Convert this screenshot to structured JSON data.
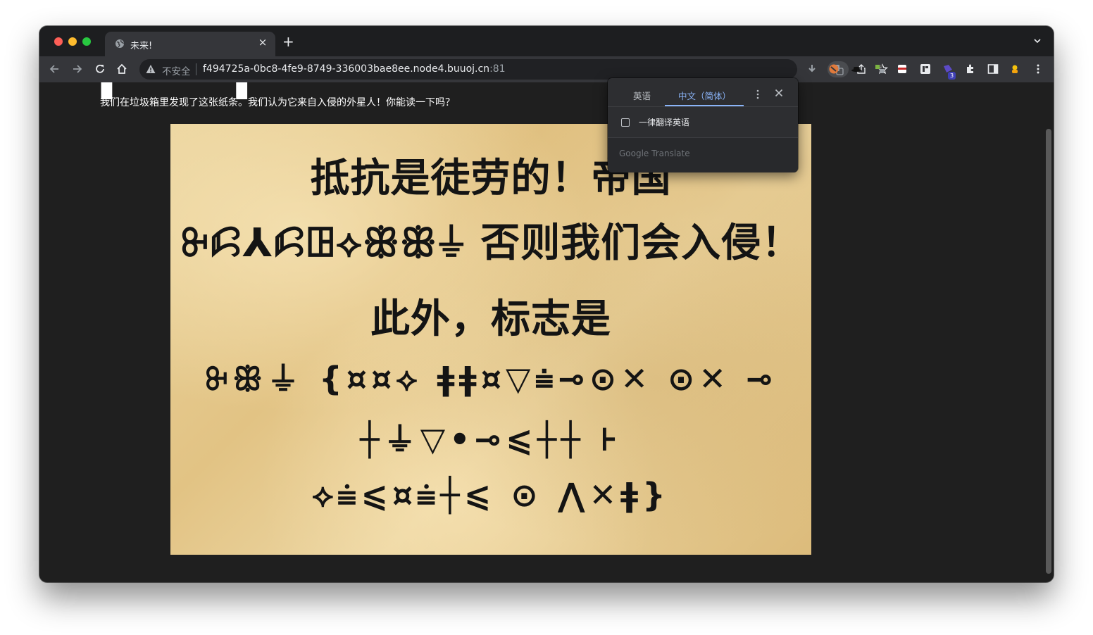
{
  "browser": {
    "tab_title": "未来!",
    "new_tab": "+",
    "close_tab": "×",
    "security_label": "不安全",
    "url_host": "f494725a-0bc8-4fe9-8749-336003bae8ee.node4.buuoj.cn",
    "url_port": ":81",
    "extension_badge": "3",
    "icons": [
      "globe-icon",
      "back-icon",
      "forward-icon",
      "reload-icon",
      "home-icon",
      "warning-icon",
      "translate-icon",
      "share-icon",
      "star-icon",
      "download-icon",
      "extensions-icon",
      "sidebar-icon",
      "menu-icon"
    ]
  },
  "page": {
    "cut_heading": "▌▔▔▔▔ ▌▔▔▔▔▔",
    "intro_text": "我们在垃圾箱里发现了这张纸条。我们认为它来自入侵的外星人！你能读一下吗？",
    "parchment_lines": [
      "抵抗是徒劳的！帝国",
      "ꔬꗲ⅄ꗲꖸ⟡ꕥꕥ⏚ 否则我们会入侵！",
      "此外，标志是",
      "ꔬꕥ⏚ {¤¤⟡ ǂǂ¤▽⩧⊸⊙✕ ⊙✕ ⊸",
      "┼⏚▽•⊸⩽┼┼ ⊦",
      "⟡⩧⩽¤⩧┼⩽ ⊙ ⋀✕ǂ}"
    ]
  },
  "translate_popup": {
    "tab_source": "英语",
    "tab_target": "中文（简体）",
    "always_translate": "一律翻译英语",
    "brand": "Google Translate",
    "accent": "#8ab4f8"
  }
}
